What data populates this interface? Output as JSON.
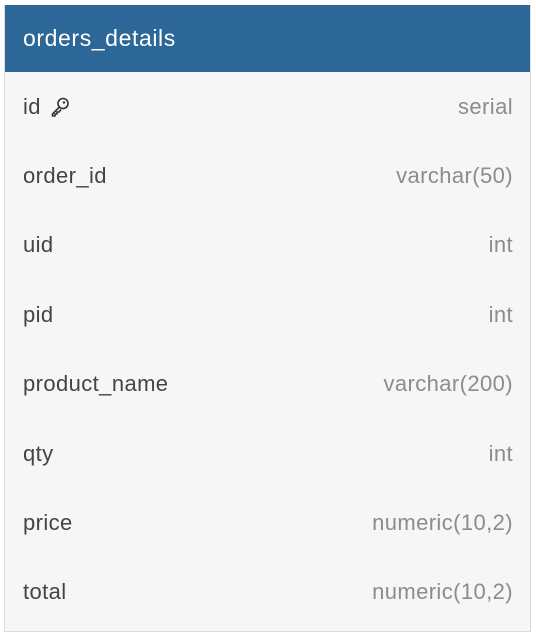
{
  "table": {
    "name": "orders_details",
    "header_color": "#2d6798",
    "columns": [
      {
        "name": "id",
        "type": "serial",
        "primary_key": true,
        "icon": "key-icon"
      },
      {
        "name": "order_id",
        "type": "varchar(50)"
      },
      {
        "name": "uid",
        "type": "int"
      },
      {
        "name": "pid",
        "type": "int"
      },
      {
        "name": "product_name",
        "type": "varchar(200)"
      },
      {
        "name": "qty",
        "type": "int"
      },
      {
        "name": "price",
        "type": "numeric(10,2)"
      },
      {
        "name": "total",
        "type": "numeric(10,2)"
      }
    ]
  }
}
